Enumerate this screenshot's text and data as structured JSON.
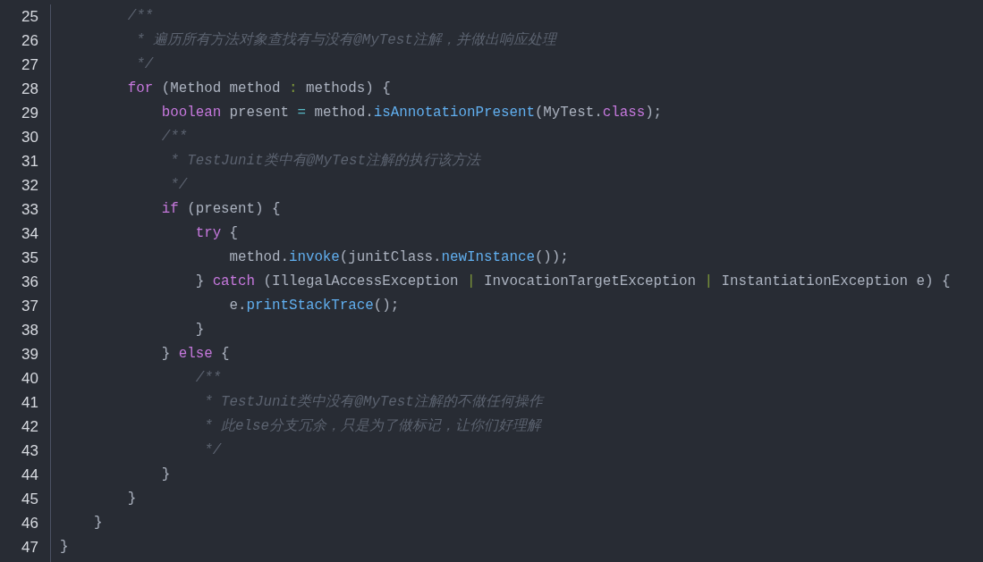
{
  "editor": {
    "lines": [
      {
        "children": [
          {
            "children": [
              {
                "number": "25",
                "tokens": [
                  {
                    "kind": "comment",
                    "text": "/**"
                  }
                ]
              },
              {
                "number": "26",
                "tokens": [
                  {
                    "kind": "comment",
                    "text": " * 遍历所有方法对象查找有与没有@MyTest注解，并做出响应处理"
                  }
                ]
              },
              {
                "number": "27",
                "tokens": [
                  {
                    "kind": "comment",
                    "text": " */"
                  }
                ]
              },
              {
                "number": "28",
                "tokens": [
                  {
                    "kind": "keyword",
                    "text": "for"
                  },
                  {
                    "kind": "plain",
                    "text": " (Method method "
                  },
                  {
                    "kind": "separator",
                    "text": ":"
                  },
                  {
                    "kind": "plain",
                    "text": " methods) {"
                  }
                ],
                "children": [
                  {
                    "number": "29",
                    "tokens": [
                      {
                        "kind": "keyword",
                        "text": "boolean"
                      },
                      {
                        "kind": "plain",
                        "text": " present "
                      },
                      {
                        "kind": "operator",
                        "text": "="
                      },
                      {
                        "kind": "plain",
                        "text": " method."
                      },
                      {
                        "kind": "method",
                        "text": "isAnnotationPresent"
                      },
                      {
                        "kind": "plain",
                        "text": "(MyTest."
                      },
                      {
                        "kind": "keyword",
                        "text": "class"
                      },
                      {
                        "kind": "plain",
                        "text": ");"
                      }
                    ]
                  },
                  {
                    "number": "30",
                    "tokens": [
                      {
                        "kind": "comment",
                        "text": "/**"
                      }
                    ]
                  },
                  {
                    "number": "31",
                    "tokens": [
                      {
                        "kind": "comment",
                        "text": " * TestJunit类中有@MyTest注解的执行该方法"
                      }
                    ]
                  },
                  {
                    "number": "32",
                    "tokens": [
                      {
                        "kind": "comment",
                        "text": " */"
                      }
                    ]
                  },
                  {
                    "number": "33",
                    "tokens": [
                      {
                        "kind": "keyword",
                        "text": "if"
                      },
                      {
                        "kind": "plain",
                        "text": " (present) {"
                      }
                    ],
                    "children": [
                      {
                        "number": "34",
                        "tokens": [
                          {
                            "kind": "keyword",
                            "text": "try"
                          },
                          {
                            "kind": "plain",
                            "text": " {"
                          }
                        ],
                        "children": [
                          {
                            "number": "35",
                            "tokens": [
                              {
                                "kind": "plain",
                                "text": "method."
                              },
                              {
                                "kind": "method",
                                "text": "invoke"
                              },
                              {
                                "kind": "plain",
                                "text": "(junitClass."
                              },
                              {
                                "kind": "method",
                                "text": "newInstance"
                              },
                              {
                                "kind": "plain",
                                "text": "());"
                              }
                            ]
                          }
                        ]
                      },
                      {
                        "number": "36",
                        "tokens": [
                          {
                            "kind": "plain",
                            "text": "} "
                          },
                          {
                            "kind": "keyword",
                            "text": "catch"
                          },
                          {
                            "kind": "plain",
                            "text": " (IllegalAccessException "
                          },
                          {
                            "kind": "separator",
                            "text": "|"
                          },
                          {
                            "kind": "plain",
                            "text": " InvocationTargetException "
                          },
                          {
                            "kind": "separator",
                            "text": "|"
                          },
                          {
                            "kind": "plain",
                            "text": " InstantiationException e) {"
                          }
                        ],
                        "children": [
                          {
                            "number": "37",
                            "tokens": [
                              {
                                "kind": "plain",
                                "text": "e."
                              },
                              {
                                "kind": "method",
                                "text": "printStackTrace"
                              },
                              {
                                "kind": "plain",
                                "text": "();"
                              }
                            ]
                          }
                        ]
                      },
                      {
                        "number": "38",
                        "tokens": [
                          {
                            "kind": "plain",
                            "text": "}"
                          }
                        ]
                      }
                    ]
                  },
                  {
                    "number": "39",
                    "tokens": [
                      {
                        "kind": "plain",
                        "text": "} "
                      },
                      {
                        "kind": "keyword",
                        "text": "else"
                      },
                      {
                        "kind": "plain",
                        "text": " {"
                      }
                    ],
                    "children": [
                      {
                        "number": "40",
                        "tokens": [
                          {
                            "kind": "comment",
                            "text": "/**"
                          }
                        ]
                      },
                      {
                        "number": "41",
                        "tokens": [
                          {
                            "kind": "comment",
                            "text": " * TestJunit类中没有@MyTest注解的不做任何操作"
                          }
                        ]
                      },
                      {
                        "number": "42",
                        "tokens": [
                          {
                            "kind": "comment",
                            "text": " * 此else分支冗余，只是为了做标记，让你们好理解"
                          }
                        ]
                      },
                      {
                        "number": "43",
                        "tokens": [
                          {
                            "kind": "comment",
                            "text": " */"
                          }
                        ]
                      }
                    ]
                  },
                  {
                    "number": "44",
                    "tokens": [
                      {
                        "kind": "plain",
                        "text": "}"
                      }
                    ]
                  }
                ]
              },
              {
                "number": "45",
                "tokens": [
                  {
                    "kind": "plain",
                    "text": "}"
                  }
                ]
              }
            ]
          },
          {
            "number": "46",
            "tokens": [
              {
                "kind": "plain",
                "text": "}"
              }
            ]
          }
        ]
      },
      {
        "number": "47",
        "tokens": [
          {
            "kind": "plain",
            "text": "}"
          }
        ]
      }
    ]
  }
}
